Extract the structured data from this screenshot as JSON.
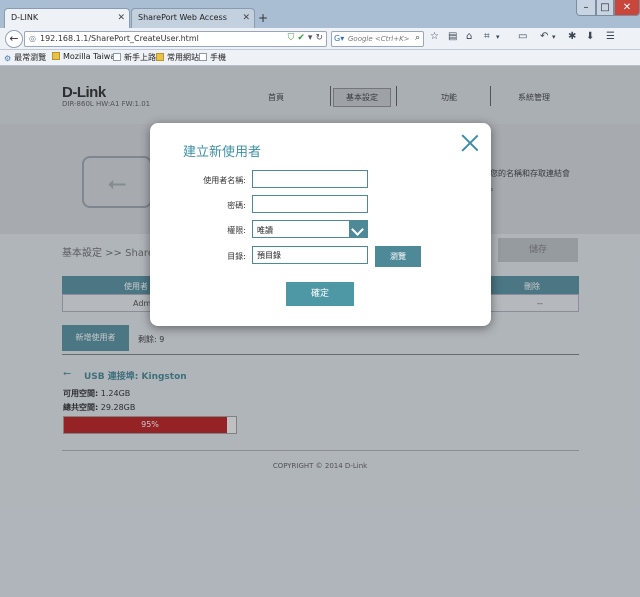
{
  "browser": {
    "tabs": [
      {
        "label": "D-LINK",
        "active": true
      },
      {
        "label": "SharePort Web Access",
        "active": false
      }
    ],
    "new_tab_symbol": "+",
    "window_controls": {
      "minimize": "–",
      "maximize": "□",
      "close": "✕"
    },
    "url": "192.168.1.1/SharePort_CreateUser.html",
    "search_placeholder": "Google <Ctrl+K>",
    "bookmarks": [
      "最常瀏覽",
      "Mozilla Taiwan",
      "新手上路",
      "常用網站",
      "手機"
    ]
  },
  "router": {
    "logo": "D-Link",
    "model": "DIR-860L   HW:A1   FW:1.01",
    "nav": [
      "首頁",
      "基本設定",
      "功能",
      "系統管理"
    ],
    "banner_text_1": "您的名稱和存取連結會",
    "banner_text_2": "。",
    "breadcrumb": "基本設定 >> ShareP",
    "save_label": "儲存",
    "table": {
      "headers": {
        "user": "使用者",
        "delete": "刪除"
      },
      "row": {
        "user": "Adm",
        "delete": "--"
      }
    },
    "add_user_label": "新增使用者",
    "remaining": "剩餘: 9",
    "usb": {
      "title": "USB 連接埠: Kingston",
      "available_label": "可用空間:",
      "available_value": "1.24GB",
      "total_label": "總共空間:",
      "total_value": "29.28GB",
      "usage_percent": 95,
      "usage_text": "95%"
    },
    "copyright": "COPYRIGHT © 2014 D-Link"
  },
  "modal": {
    "title": "建立新使用者",
    "username_label": "使用者名稱:",
    "username_value": "",
    "password_label": "密碼:",
    "password_value": "",
    "permission_label": "權限:",
    "permission_value": "唯讀",
    "directory_label": "目錄:",
    "directory_value": "預目錄",
    "browse_label": "瀏覽",
    "ok_label": "確定"
  },
  "colors": {
    "accent": "#4e8998",
    "title_teal": "#3e8fa6",
    "usage_red": "#b81212"
  }
}
